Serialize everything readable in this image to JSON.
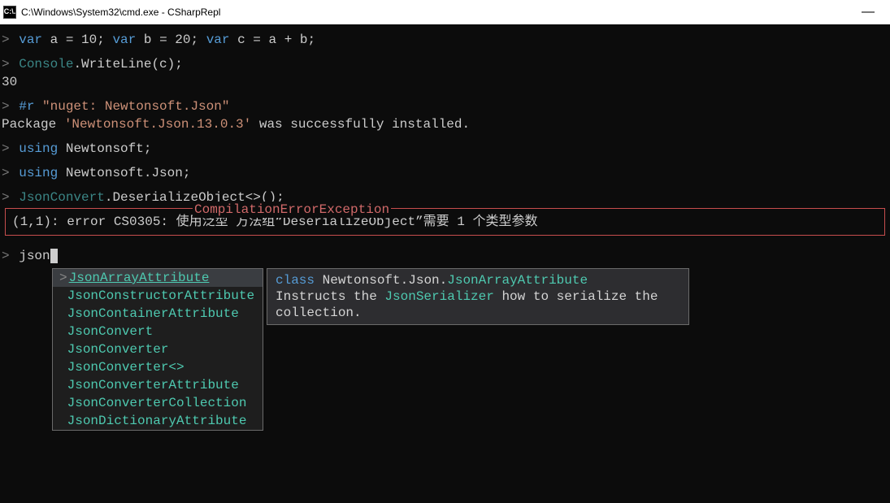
{
  "titlebar": {
    "icon_text": "C:\\.",
    "title": "C:\\Windows\\System32\\cmd.exe - CSharpRepl",
    "minimize": "—"
  },
  "lines": {
    "l1": {
      "prompt": ">",
      "kw_var1": "var",
      "rest1": " a = 10; ",
      "kw_var2": "var",
      "rest2": " b = 20; ",
      "kw_var3": "var",
      "rest3": " c = a + b;"
    },
    "l2": {
      "prompt": ">",
      "ty": "Console",
      "rest": ".WriteLine(c);"
    },
    "l2out": "30",
    "l3": {
      "prompt": ">",
      "dir": "#r",
      "str": " \"nuget: Newtonsoft.Json\""
    },
    "l3out": {
      "a": "Package ",
      "pkg": "'Newtonsoft.Json.13.0.3'",
      "b": " was successfully installed."
    },
    "l4": {
      "prompt": ">",
      "kw": "using",
      "rest": " Newtonsoft;"
    },
    "l5": {
      "prompt": ">",
      "kw": "using",
      "rest": " Newtonsoft.Json;"
    },
    "l6": {
      "prompt": ">",
      "ty": "JsonConvert",
      "rest": ".DeserializeObject<>();"
    },
    "err": {
      "label": "CompilationErrorException",
      "msg": "(1,1): error CS0305: 使用泛型 方法组“DeserializeObject”需要 1 个类型参数"
    },
    "l7": {
      "prompt": ">",
      "typed": "json",
      "cursor": " "
    }
  },
  "intellisense": {
    "items": [
      "JsonArrayAttribute",
      "JsonConstructorAttribute",
      "JsonContainerAttribute",
      "JsonConvert",
      "JsonConverter",
      "JsonConverter<>",
      "JsonConverterAttribute",
      "JsonConverterCollection",
      "JsonDictionaryAttribute"
    ],
    "selected_index": 0,
    "doc": {
      "kw": "class",
      "ns": " Newtonsoft.Json.",
      "ty": "JsonArrayAttribute",
      "body_a": "Instructs the ",
      "body_hl": "JsonSerializer",
      "body_b": " how to serialize the collection."
    }
  }
}
